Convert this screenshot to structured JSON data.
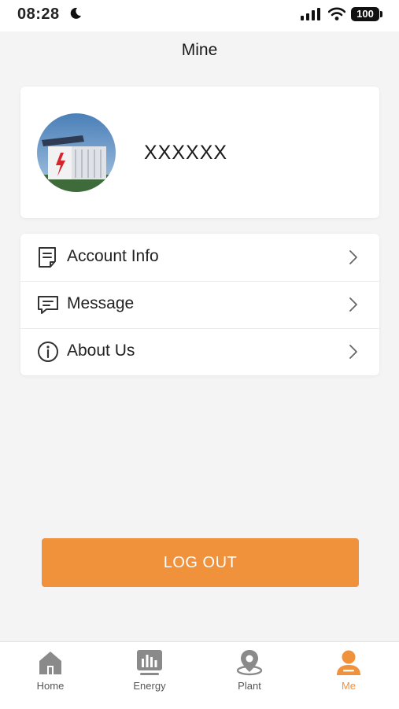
{
  "status_bar": {
    "time": "08:28",
    "battery": "100"
  },
  "header": {
    "title": "Mine"
  },
  "profile": {
    "username": "XXXXXX"
  },
  "menu": [
    {
      "label": "Account Info",
      "icon": "document-icon"
    },
    {
      "label": "Message",
      "icon": "message-icon"
    },
    {
      "label": "About Us",
      "icon": "info-icon"
    }
  ],
  "logout": {
    "label": "LOG OUT"
  },
  "nav": [
    {
      "label": "Home",
      "icon": "home-icon",
      "active": false
    },
    {
      "label": "Energy",
      "icon": "energy-icon",
      "active": false
    },
    {
      "label": "Plant",
      "icon": "plant-icon",
      "active": false
    },
    {
      "label": "Me",
      "icon": "me-icon",
      "active": true
    }
  ],
  "colors": {
    "accent": "#f0913c",
    "inactive": "#8a8a8a",
    "background": "#f4f4f4"
  }
}
